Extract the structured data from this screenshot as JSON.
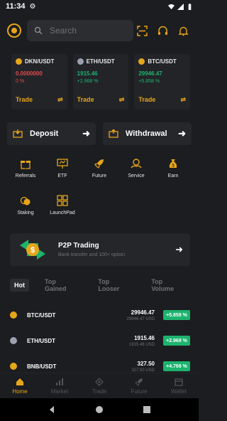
{
  "status_bar": {
    "time": "11:34"
  },
  "search": {
    "placeholder": "Search"
  },
  "tickers": [
    {
      "pair": "DKN/USDT",
      "price": "0.0000000",
      "change": "0 %",
      "trade_label": "Trade",
      "price_color": "#e14b4b",
      "change_color": "#e14b4b",
      "coin_color": "#e6a61a"
    },
    {
      "pair": "ETH/USDT",
      "price": "1915.46",
      "change": "+2.968 %",
      "trade_label": "Trade",
      "price_color": "#1db36e",
      "change_color": "#1db36e",
      "coin_color": "#9aa0ae"
    },
    {
      "pair": "BTC/USDT",
      "price": "29946.47",
      "change": "+5.858 %",
      "trade_label": "Trade",
      "price_color": "#1db36e",
      "change_color": "#1db36e",
      "coin_color": "#e6a61a"
    }
  ],
  "actions": {
    "deposit": "Deposit",
    "withdrawal": "Withdrawal"
  },
  "grid": [
    [
      {
        "label": "Referrals",
        "icon": "gift-icon"
      },
      {
        "label": "ETF",
        "icon": "presentation-icon"
      },
      {
        "label": "Future",
        "icon": "rocket-icon"
      },
      {
        "label": "Service",
        "icon": "service-icon"
      },
      {
        "label": "Earn",
        "icon": "money-bag-icon"
      }
    ],
    [
      {
        "label": "Staking",
        "icon": "coins-icon"
      },
      {
        "label": "LaunchPad",
        "icon": "launchpad-icon"
      }
    ]
  ],
  "p2p": {
    "title": "P2P Trading",
    "subtitle": "Bank transfer and 100+ option"
  },
  "tabs": [
    "Hot",
    "Top Gained",
    "Top Looser",
    "Top Volume"
  ],
  "markets": [
    {
      "pair": "BTC/USDT",
      "price": "29946.47",
      "usd": "29946.47 USD",
      "change": "+5.858 %",
      "coin_color": "#e6a61a"
    },
    {
      "pair": "ETH/USDT",
      "price": "1915.46",
      "usd": "1915.46 USD",
      "change": "+2.968 %",
      "coin_color": "#9aa0ae"
    },
    {
      "pair": "BNB/USDT",
      "price": "327.50",
      "usd": "327.50 USD",
      "change": "+4.766 %",
      "coin_color": "#e6a61a"
    }
  ],
  "bottom_nav": [
    {
      "label": "Home",
      "icon": "home-icon",
      "active": true
    },
    {
      "label": "Market",
      "icon": "bar-chart-icon",
      "active": false
    },
    {
      "label": "Trade",
      "icon": "trade-icon",
      "active": false
    },
    {
      "label": "Future",
      "icon": "rocket-icon",
      "active": false
    },
    {
      "label": "Wallet",
      "icon": "wallet-icon",
      "active": false
    }
  ],
  "colors": {
    "accent": "#e6a61a",
    "up": "#1db36e",
    "down": "#e14b4b",
    "background": "#1c1d20"
  }
}
